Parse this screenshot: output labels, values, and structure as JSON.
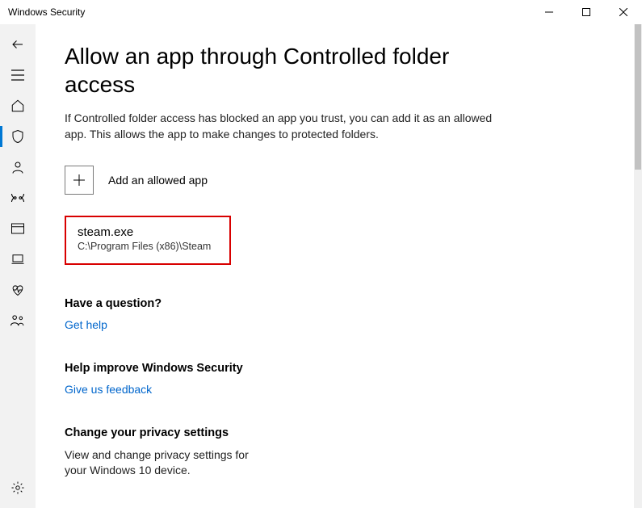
{
  "titlebar": {
    "title": "Windows Security"
  },
  "page": {
    "heading": "Allow an app through Controlled folder access",
    "description": "If Controlled folder access has blocked an app you trust, you can add it as an allowed app. This allows the app to make changes to protected folders.",
    "add_label": "Add an allowed app"
  },
  "app": {
    "name": "steam.exe",
    "path": "C:\\Program Files (x86)\\Steam"
  },
  "question": {
    "heading": "Have a question?",
    "link": "Get help"
  },
  "improve": {
    "heading": "Help improve Windows Security",
    "link": "Give us feedback"
  },
  "privacy": {
    "heading": "Change your privacy settings",
    "desc": "View and change privacy settings for your Windows 10 device."
  }
}
